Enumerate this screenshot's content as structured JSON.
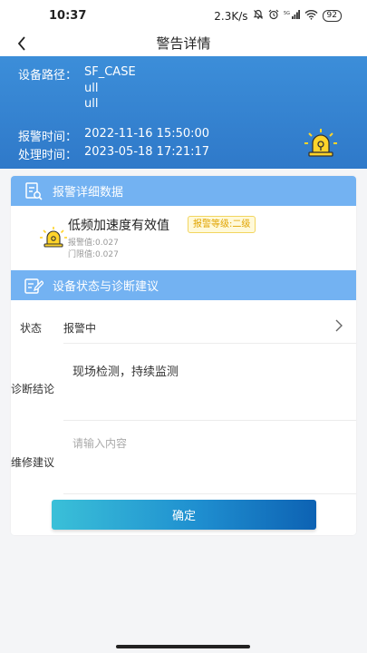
{
  "status_bar": {
    "time": "10:37",
    "network_speed": "2.3K/s",
    "signal": "5G",
    "battery": "92",
    "icons": [
      "mute-icon",
      "alarm-clock-icon",
      "signal-icon",
      "wifi-icon",
      "battery-icon"
    ]
  },
  "nav": {
    "title": "警告详情",
    "back_icon": "chevron-left-icon"
  },
  "header": {
    "device_path_label": "设备路径：",
    "device_path_lines": [
      "SF_CASE",
      "ull",
      "ull"
    ],
    "alarm_time_label": "报警时间：",
    "alarm_time": "2022-11-16 15:50:00",
    "process_time_label": "处理时间：",
    "process_time": "2023-05-18 17:21:17",
    "icon": "alarm-siren-icon",
    "bg_color": "#3788d6"
  },
  "alarm_detail": {
    "section_title": "报警详细数据",
    "section_icon": "document-search-icon",
    "item": {
      "name": "低频加速度有效值",
      "level": "报警等级:二级",
      "alarm_value": "报警值:0.027",
      "threshold_value": "门限值:0.027",
      "icon": "alarm-siren-icon",
      "level_color": "#e0a400"
    }
  },
  "diagnosis": {
    "section_title": "设备状态与诊断建议",
    "section_icon": "edit-note-icon",
    "status_label": "状态",
    "status_value": "报警中",
    "conclusion_label": "诊断结论",
    "conclusion_text": "现场检测，持续监测",
    "repair_label": "维修建议",
    "repair_placeholder": "请输入内容"
  },
  "actions": {
    "confirm_label": "确定"
  },
  "colors": {
    "section_header": "#73b2f2",
    "button_start": "#3ac0d8",
    "button_end": "#0d62b3"
  }
}
